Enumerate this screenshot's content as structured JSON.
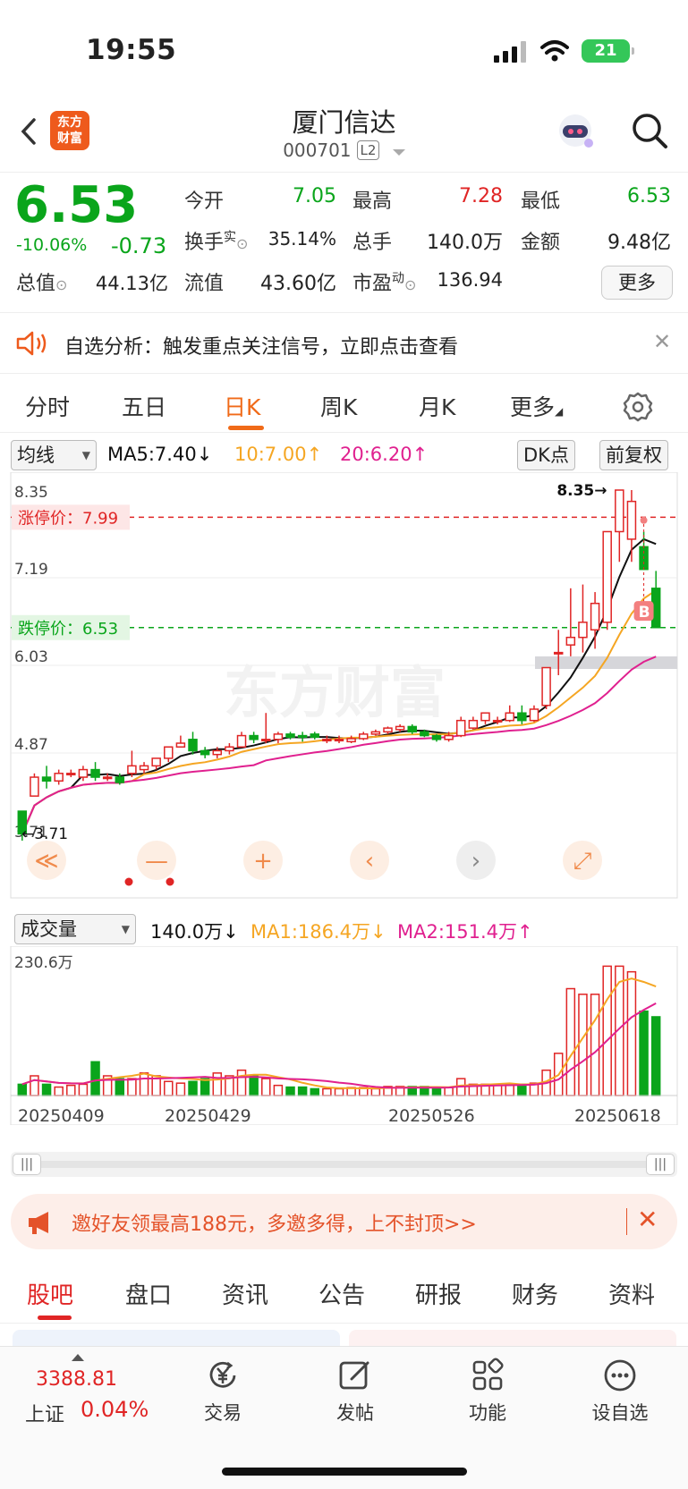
{
  "status": {
    "time": "19:55",
    "battery": "21"
  },
  "header": {
    "logo_text": "东方财富",
    "title": "厦门信达",
    "code": "000701",
    "level": "L2"
  },
  "quote": {
    "price": "6.53",
    "change_pct": "-10.06%",
    "change": "-0.73",
    "open_label": "今开",
    "open": "7.05",
    "high_label": "最高",
    "high": "7.28",
    "low_label": "最低",
    "low": "6.53",
    "turnover_label": "换手",
    "turnover_sup": "实",
    "turnover": "35.14%",
    "volume_label": "总手",
    "volume": "140.0万",
    "amount_label": "金额",
    "amount": "9.48亿",
    "mcap_label": "总值",
    "mcap": "44.13亿",
    "float_label": "流值",
    "float": "43.60亿",
    "pe_label": "市盈",
    "pe_sup": "动",
    "pe": "136.94",
    "more_label": "更多"
  },
  "notice": {
    "text": "自选分析：触发重点关注信号，立即点击查看"
  },
  "tabs": [
    "分时",
    "五日",
    "日K",
    "周K",
    "月K",
    "更多"
  ],
  "chart_controls": {
    "ma_select": "均线",
    "ma5": "MA5:7.40",
    "ma10": "10:7.00",
    "ma20": "20:6.20",
    "dk_label": "DK点",
    "adjust_label": "前复权",
    "vol_select": "成交量",
    "vol_value": "140.0万",
    "vol_ma1": "MA1:186.4万",
    "vol_ma2": "MA2:151.4万"
  },
  "chart_data": [
    {
      "type": "candlestick",
      "y_ticks": [
        "8.35",
        "7.19",
        "6.03",
        "4.87",
        "3.71"
      ],
      "ylim": [
        3.71,
        8.35
      ],
      "limit_up_label": "涨停价：7.99",
      "limit_up": 7.99,
      "limit_down_label": "跌停价：6.53",
      "limit_down": 6.53,
      "max_label": "8.35",
      "min_label": "3.71",
      "buy_marker": "B",
      "watermark": "东方财富",
      "candles": [
        [
          4.1,
          3.8,
          4.1,
          3.71
        ],
        [
          4.3,
          4.55,
          4.6,
          4.3
        ],
        [
          4.55,
          4.5,
          4.7,
          4.4
        ],
        [
          4.5,
          4.6,
          4.65,
          4.45
        ],
        [
          4.6,
          4.6,
          4.65,
          4.55
        ],
        [
          4.55,
          4.65,
          4.7,
          4.5
        ],
        [
          4.65,
          4.55,
          4.75,
          4.5
        ],
        [
          4.55,
          4.55,
          4.6,
          4.5
        ],
        [
          4.55,
          4.48,
          4.6,
          4.45
        ],
        [
          4.6,
          4.7,
          4.9,
          4.55
        ],
        [
          4.65,
          4.7,
          4.75,
          4.6
        ],
        [
          4.7,
          4.8,
          4.8,
          4.65
        ],
        [
          4.8,
          4.95,
          4.95,
          4.75
        ],
        [
          4.95,
          5.0,
          5.1,
          4.95
        ],
        [
          5.05,
          4.9,
          5.15,
          4.85
        ],
        [
          4.9,
          4.85,
          4.95,
          4.8
        ],
        [
          4.85,
          4.9,
          4.95,
          4.8
        ],
        [
          4.9,
          4.95,
          5.0,
          4.85
        ],
        [
          4.95,
          5.1,
          5.15,
          4.95
        ],
        [
          5.1,
          5.05,
          5.15,
          5.0
        ],
        [
          5.05,
          5.05,
          5.4,
          5.0
        ],
        [
          5.05,
          5.12,
          5.15,
          5.0
        ],
        [
          5.12,
          5.08,
          5.15,
          5.05
        ],
        [
          5.1,
          5.08,
          5.15,
          5.02
        ],
        [
          5.12,
          5.08,
          5.15,
          5.05
        ],
        [
          5.05,
          5.05,
          5.1,
          5.0
        ],
        [
          5.05,
          5.05,
          5.1,
          5.0
        ],
        [
          5.02,
          5.06,
          5.1,
          5.0
        ],
        [
          5.06,
          5.12,
          5.15,
          5.04
        ],
        [
          5.12,
          5.15,
          5.18,
          5.1
        ],
        [
          5.15,
          5.2,
          5.22,
          5.12
        ],
        [
          5.18,
          5.22,
          5.25,
          5.15
        ],
        [
          5.22,
          5.15,
          5.25,
          5.12
        ],
        [
          5.15,
          5.1,
          5.18,
          5.08
        ],
        [
          5.1,
          5.05,
          5.12,
          5.02
        ],
        [
          5.05,
          5.1,
          5.15,
          5.02
        ],
        [
          5.1,
          5.3,
          5.35,
          5.08
        ],
        [
          5.2,
          5.3,
          5.35,
          5.18
        ],
        [
          5.3,
          5.4,
          5.4,
          5.25
        ],
        [
          5.3,
          5.3,
          5.35,
          5.25
        ],
        [
          5.3,
          5.4,
          5.5,
          5.28
        ],
        [
          5.4,
          5.3,
          5.5,
          5.25
        ],
        [
          5.3,
          5.45,
          5.5,
          5.28
        ],
        [
          5.5,
          6.0,
          6.0,
          5.45
        ],
        [
          6.2,
          6.2,
          6.5,
          5.9
        ],
        [
          6.3,
          6.4,
          7.05,
          6.15
        ],
        [
          6.4,
          6.6,
          7.1,
          6.2
        ],
        [
          6.5,
          6.85,
          7.0,
          6.25
        ],
        [
          6.6,
          7.8,
          7.8,
          6.5
        ],
        [
          7.8,
          8.35,
          8.35,
          7.4
        ],
        [
          7.7,
          8.2,
          8.35,
          7.4
        ],
        [
          7.6,
          7.3,
          7.8,
          7.3
        ],
        [
          7.05,
          6.53,
          7.28,
          6.53
        ]
      ]
    },
    {
      "type": "bar",
      "y_ticks": [
        "230.6万"
      ],
      "ylim": [
        0,
        230.6
      ],
      "x_labels": [
        "20250409",
        "20250429",
        "20250526",
        "20250618"
      ],
      "values": [
        20,
        35,
        20,
        15,
        18,
        20,
        60,
        35,
        30,
        30,
        40,
        35,
        25,
        22,
        25,
        30,
        40,
        35,
        45,
        35,
        30,
        18,
        15,
        15,
        12,
        12,
        12,
        14,
        14,
        12,
        16,
        16,
        16,
        16,
        12,
        14,
        30,
        20,
        20,
        18,
        20,
        20,
        22,
        45,
        75,
        190,
        180,
        180,
        230,
        230,
        220,
        150,
        140
      ]
    }
  ]
}
